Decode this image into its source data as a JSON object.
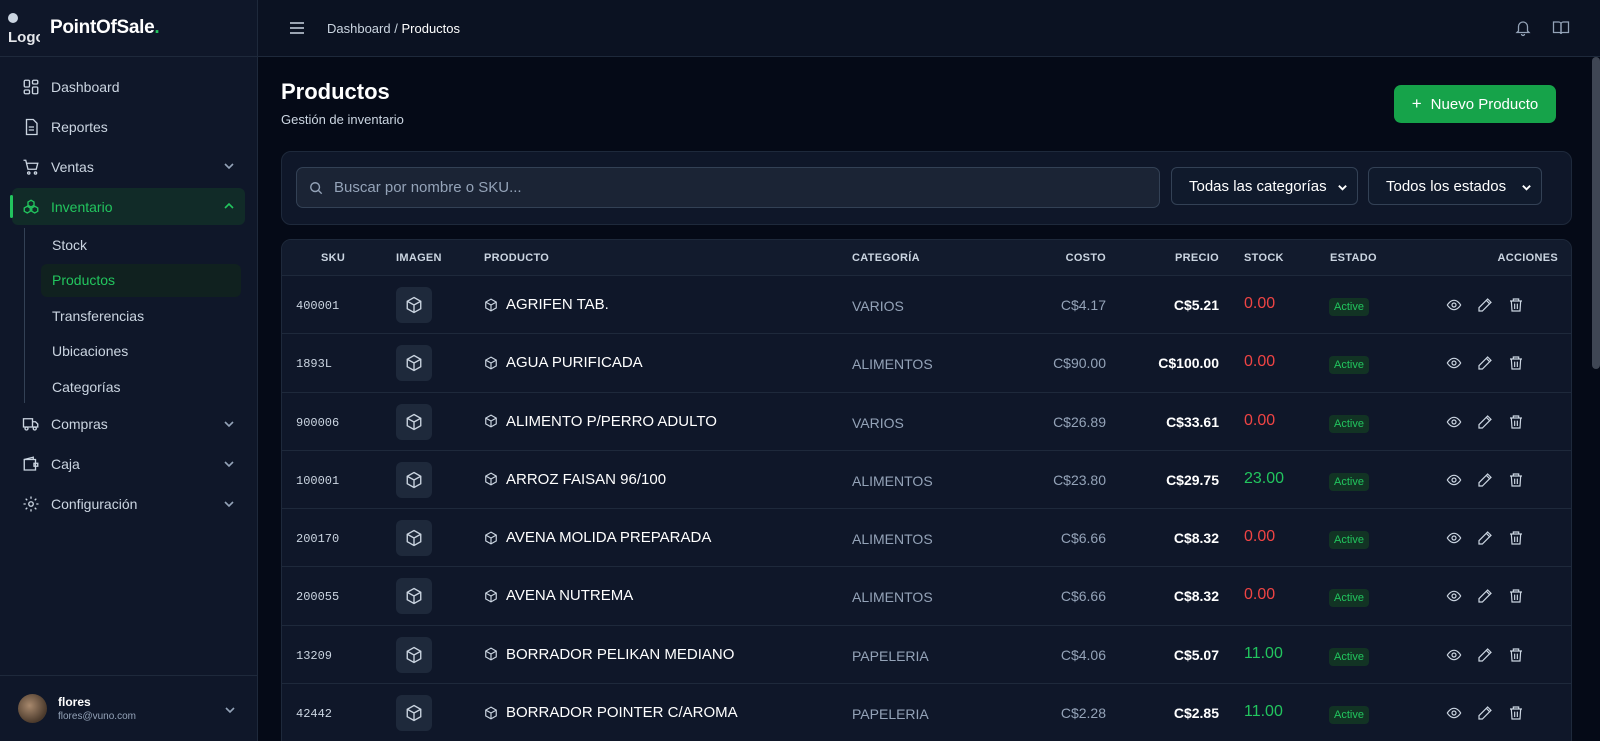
{
  "app": {
    "logo_alt": "Logo",
    "name": "PointOfSale",
    "name_dot": "."
  },
  "sidebar": {
    "items": [
      {
        "label": "Dashboard",
        "icon": "grid-icon"
      },
      {
        "label": "Reportes",
        "icon": "document-icon"
      },
      {
        "label": "Ventas",
        "icon": "cart-icon",
        "expandable": true
      },
      {
        "label": "Inventario",
        "icon": "boxes-icon",
        "expandable": true,
        "expanded": true,
        "active": true
      },
      {
        "label": "Compras",
        "icon": "truck-icon",
        "expandable": true
      },
      {
        "label": "Caja",
        "icon": "wallet-icon",
        "expandable": true
      },
      {
        "label": "Configuración",
        "icon": "gear-icon",
        "expandable": true
      }
    ],
    "inventario_sub": [
      "Stock",
      "Productos",
      "Transferencias",
      "Ubicaciones",
      "Categorías"
    ],
    "active_sub": "Productos"
  },
  "user": {
    "name": "flores",
    "email": "flores@vuno.com"
  },
  "topbar": {
    "crumb_parent": "Dashboard",
    "crumb_sep": "/",
    "crumb_current": "Productos"
  },
  "page": {
    "title": "Productos",
    "subtitle": "Gestión de inventario",
    "new_button": "Nuevo Producto"
  },
  "filters": {
    "search_placeholder": "Buscar por nombre o SKU...",
    "category_selected": "Todas las categorías",
    "status_selected": "Todos los estados"
  },
  "table": {
    "headers": {
      "sku": "SKU",
      "image": "IMAGEN",
      "product": "PRODUCTO",
      "category": "CATEGORÍA",
      "cost": "COSTO",
      "price": "PRECIO",
      "stock": "STOCK",
      "status": "ESTADO",
      "actions": "ACCIONES"
    },
    "rows": [
      {
        "sku": "400001",
        "product": "AGRIFEN TAB.",
        "category": "VARIOS",
        "cost": "C$4.17",
        "price": "C$5.21",
        "stock": "0.00",
        "status": "Active"
      },
      {
        "sku": "1893L",
        "product": "AGUA PURIFICADA",
        "category": "ALIMENTOS",
        "cost": "C$90.00",
        "price": "C$100.00",
        "stock": "0.00",
        "status": "Active"
      },
      {
        "sku": "900006",
        "product": "ALIMENTO P/PERRO ADULTO",
        "category": "VARIOS",
        "cost": "C$26.89",
        "price": "C$33.61",
        "stock": "0.00",
        "status": "Active"
      },
      {
        "sku": "100001",
        "product": "ARROZ FAISAN 96/100",
        "category": "ALIMENTOS",
        "cost": "C$23.80",
        "price": "C$29.75",
        "stock": "23.00",
        "status": "Active"
      },
      {
        "sku": "200170",
        "product": "AVENA MOLIDA PREPARADA",
        "category": "ALIMENTOS",
        "cost": "C$6.66",
        "price": "C$8.32",
        "stock": "0.00",
        "status": "Active"
      },
      {
        "sku": "200055",
        "product": "AVENA NUTREMA",
        "category": "ALIMENTOS",
        "cost": "C$6.66",
        "price": "C$8.32",
        "stock": "0.00",
        "status": "Active"
      },
      {
        "sku": "13209",
        "product": "BORRADOR PELIKAN MEDIANO",
        "category": "PAPELERIA",
        "cost": "C$4.06",
        "price": "C$5.07",
        "stock": "11.00",
        "status": "Active"
      },
      {
        "sku": "42442",
        "product": "BORRADOR POINTER C/AROMA",
        "category": "PAPELERIA",
        "cost": "C$2.28",
        "price": "C$2.85",
        "stock": "11.00",
        "status": "Active"
      }
    ]
  },
  "colors": {
    "accent": "#22c55e",
    "button": "#16a34a",
    "danger": "#ef4444",
    "background": "#050a17",
    "sidebar": "#0f1729"
  }
}
